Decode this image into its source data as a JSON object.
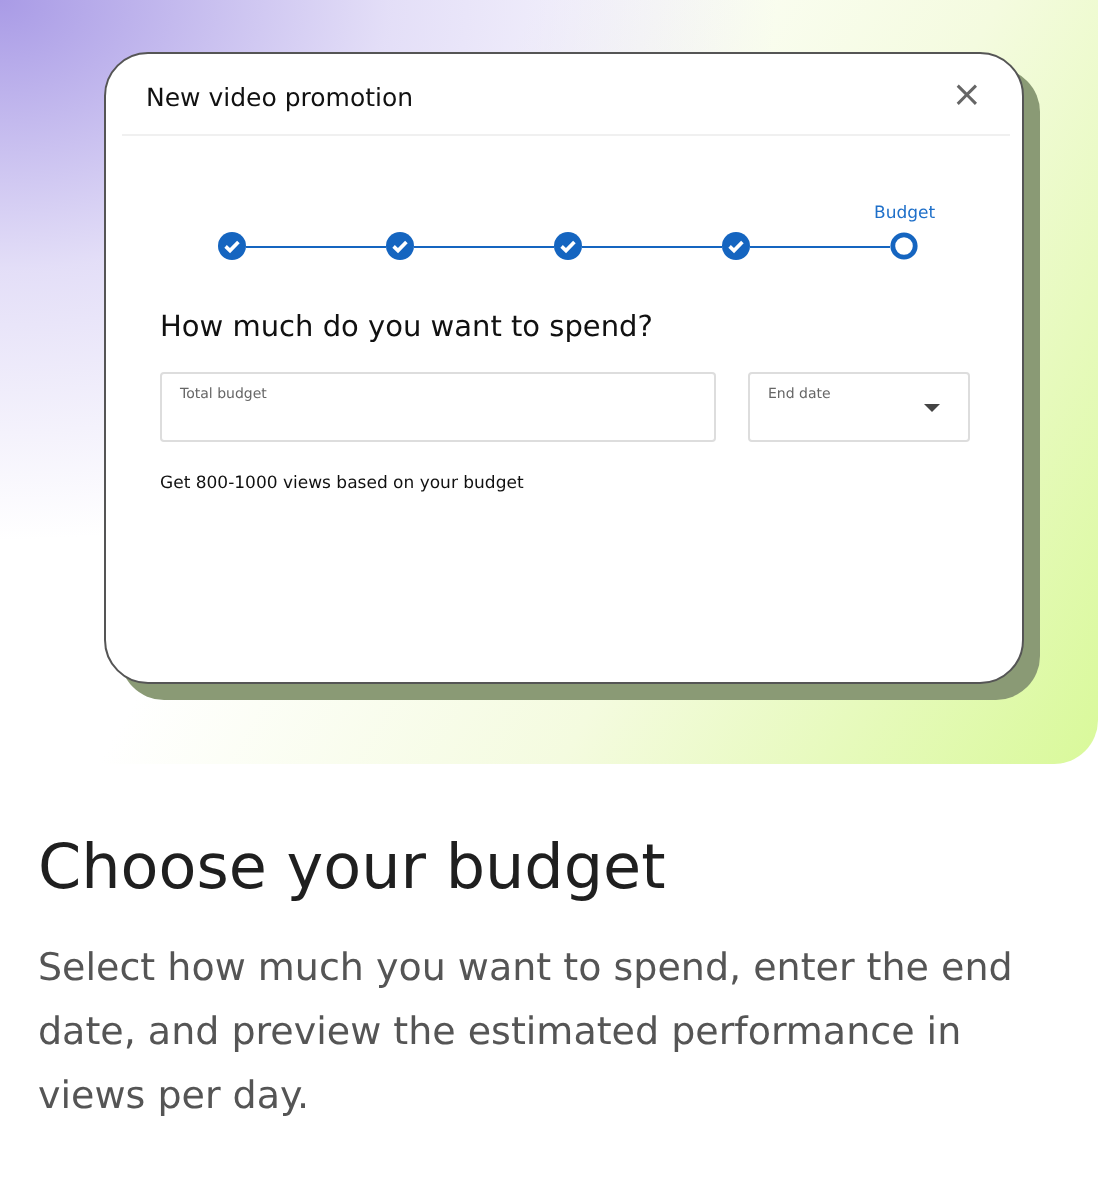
{
  "dialog": {
    "title": "New video promotion",
    "close": "×",
    "steps": [
      {
        "completed": true
      },
      {
        "completed": true
      },
      {
        "completed": true
      },
      {
        "completed": true
      },
      {
        "completed": false,
        "label": "Budget"
      }
    ],
    "question": "How much do you want to spend?",
    "fields": [
      {
        "kind": "text",
        "label": "Total budget"
      },
      {
        "kind": "dropdown",
        "label": "End date"
      }
    ],
    "estimate": "Get 800-1000 views based on your budget"
  },
  "heading": "Choose your budget",
  "description": "Select how much you want to spend, enter the end date, and preview the estimated performance in views per day."
}
